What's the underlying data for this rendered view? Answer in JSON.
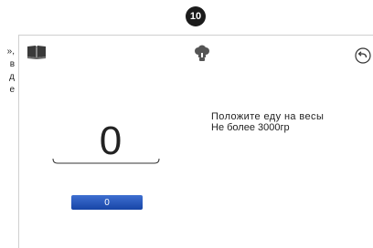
{
  "step": {
    "number": "10"
  },
  "side_text": [
    "»,",
    "в",
    "д",
    "е"
  ],
  "toolbar": {
    "left_icon": "recipe-book-icon",
    "center_icon": "chef-hat-icon",
    "right_icon": "back-arrow-icon"
  },
  "scale": {
    "display_value": "0",
    "button_label": "0"
  },
  "message": {
    "line1": "Положите еду на весы",
    "line2": "Не более 3000гр"
  },
  "colors": {
    "button_top": "#3e6fd1",
    "button_bottom": "#1745a6",
    "badge": "#1b1b1b"
  }
}
